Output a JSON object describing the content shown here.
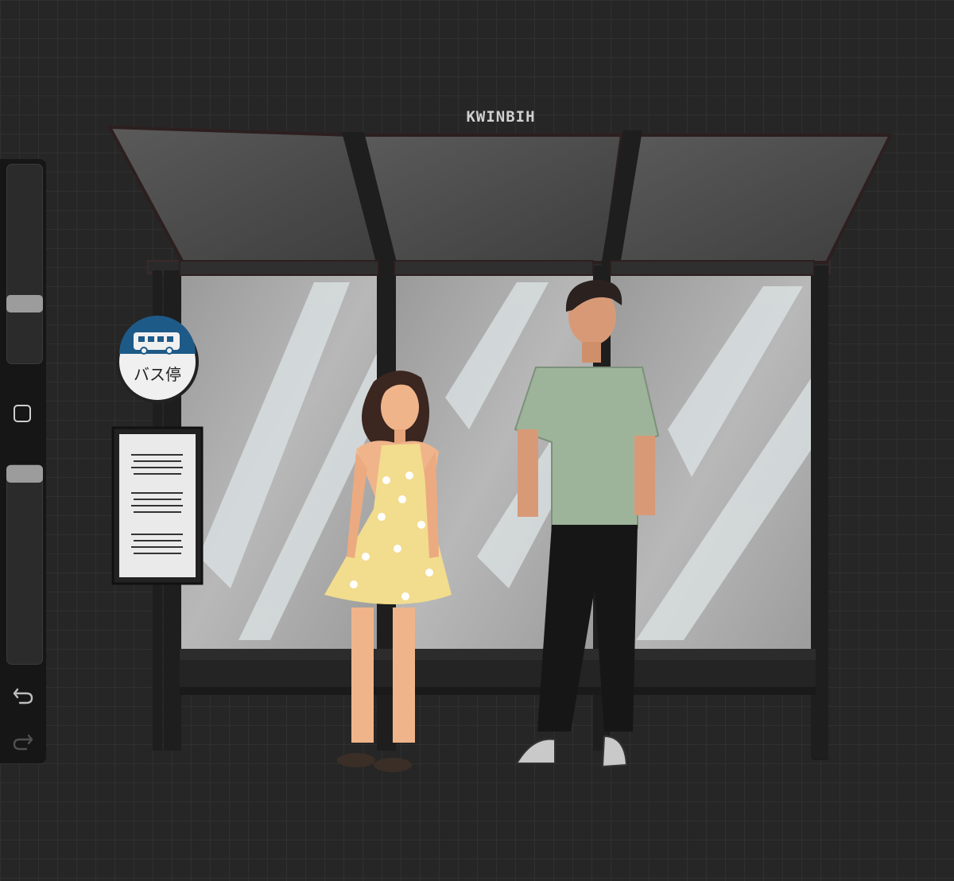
{
  "artwork": {
    "signature": "KWINBIH",
    "sign_text": "バス停",
    "description_subjects": []
  },
  "sidebar": {
    "brush_size_slider": {
      "value": 0.72
    },
    "opacity_slider": {
      "value": 0.0
    },
    "modify_button_icon": "square-icon",
    "undo_icon": "undo-arrow-icon",
    "redo_icon": "redo-arrow-icon"
  },
  "colors": {
    "canvas_bg": "#262626",
    "grid": "#303030",
    "sign_blue": "#1d5a88",
    "dress_yellow": "#f2dc8d",
    "shirt_green": "#9eb49a"
  }
}
